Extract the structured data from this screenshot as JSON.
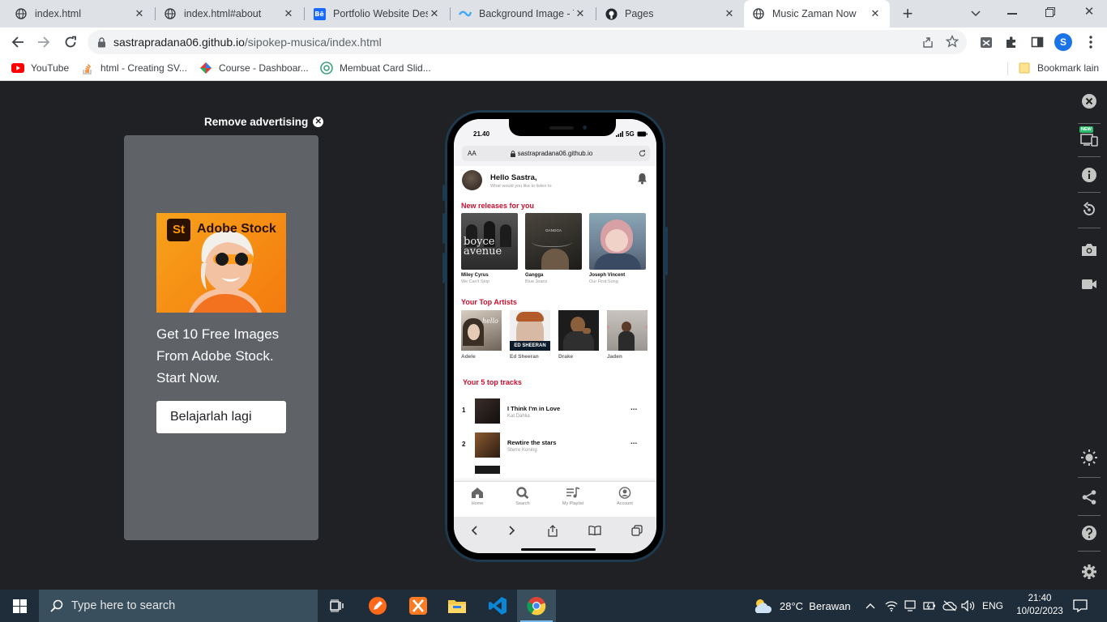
{
  "browser": {
    "tabs": [
      {
        "title": "index.html",
        "icon": "globe-icon"
      },
      {
        "title": "index.html#about",
        "icon": "globe-icon"
      },
      {
        "title": "Portfolio Website Desi",
        "icon": "behance-icon"
      },
      {
        "title": "Background Image - T",
        "icon": "wave-icon"
      },
      {
        "title": "Pages",
        "icon": "github-icon"
      },
      {
        "title": "Music Zaman Now",
        "icon": "globe-icon",
        "active": true
      }
    ],
    "new_tab_label": "+",
    "address": {
      "host": "sastrapradana06.github.io",
      "path": "/sipokep-musica/index.html"
    },
    "profile_initial": "S",
    "bookmarks": [
      {
        "label": "YouTube",
        "icon": "youtube-icon"
      },
      {
        "label": "html - Creating SV...",
        "icon": "stackoverflow-icon"
      },
      {
        "label": "Course - Dashboar...",
        "icon": "course-icon"
      },
      {
        "label": "Membuat Card Slid...",
        "icon": "card-icon"
      }
    ],
    "other_bookmarks": "Bookmark lain"
  },
  "ad": {
    "remove_label": "Remove advertising",
    "brand_badge": "St",
    "brand_name": "Adobe Stock",
    "headline": "Get 10 Free Images From Adobe Stock. Start Now.",
    "button": "Belajarlah lagi"
  },
  "rail": {
    "new_badge": "NEW"
  },
  "phone": {
    "time": "21.40",
    "network": "5G",
    "safari_aa": "AA",
    "safari_url": "sastrapradana06.github.io",
    "greeting": "Hello Sastra,",
    "subtitle": "What would you like to listen to",
    "new_releases_title": "New releases for you",
    "new_releases": [
      {
        "title": "Miley Cyrus",
        "subtitle": "We Can't Stop",
        "cover_text": "boyce avenue"
      },
      {
        "title": "Gangga",
        "subtitle": "Blue Jeans",
        "cover_text": "GANGGA"
      },
      {
        "title": "Joseph Vincent",
        "subtitle": "Our First Song",
        "cover_text": ""
      }
    ],
    "top_artists_title": "Your Top Artists",
    "top_artists": [
      {
        "name": "Adele",
        "cover_text": "hello"
      },
      {
        "name": "Ed Sheeran",
        "cover_text": "ED SHEERAN"
      },
      {
        "name": "Drake",
        "cover_text": ""
      },
      {
        "name": "Jaden",
        "cover_text": ""
      }
    ],
    "top_tracks_title": "Your 5 top tracks",
    "top_tracks": [
      {
        "rank": "1",
        "title": "I Think I'm in Love",
        "artist": "Kat Dahlia"
      },
      {
        "rank": "2",
        "title": "Rewtire the stars",
        "artist": "Sterre Koning"
      }
    ],
    "more_label": "...",
    "nav": [
      {
        "label": "Home",
        "icon": "home-icon"
      },
      {
        "label": "Search",
        "icon": "search-icon"
      },
      {
        "label": "My Playlist",
        "icon": "playlist-icon"
      },
      {
        "label": "Account",
        "icon": "account-icon"
      }
    ]
  },
  "taskbar": {
    "search_placeholder": "Type here to search",
    "weather": "28°C  Berawan",
    "lang": "ENG",
    "time": "21:40",
    "date": "10/02/2023"
  },
  "colors": {
    "accent": "#c8102e",
    "adobe_orange": "#f47b0e",
    "chrome_blue": "#1a73e8"
  }
}
